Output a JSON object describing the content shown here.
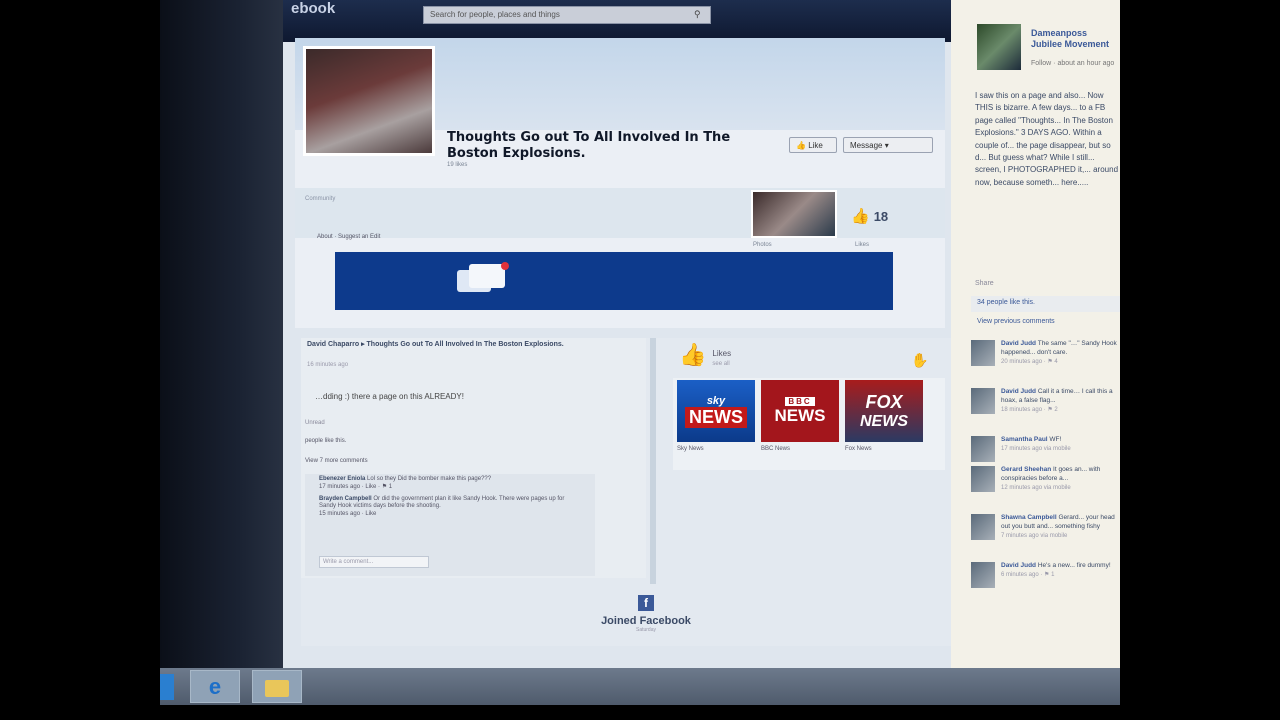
{
  "facebook": {
    "logo_text": "ebook",
    "search_placeholder": "Search for people, places and things"
  },
  "page": {
    "title": "Thoughts Go out To All Involved In The Boston Explosions.",
    "subtitle": "19 likes",
    "like_button": "Like",
    "message_button": "Message",
    "info_text": "Community",
    "tab_links": "About · Suggest an Edit",
    "photos_label": "Photos",
    "likes_count": "18",
    "likes_label": "Likes"
  },
  "post": {
    "author_line": "David Chaparro ▸ Thoughts Go out To All Involved In The Boston Explosions.",
    "time": "16 minutes ago",
    "body": "…dding :) there a page on this ALREADY!",
    "header": "Unread",
    "likes_this": "people like this.",
    "view_more": "View 7 more comments",
    "comments": [
      {
        "author": "Ebenezer Eniola",
        "text": "Lol so they Did the bomber make this page???",
        "meta": "17 minutes ago · Like · ⚑ 1"
      },
      {
        "author": "Brayden Campbell",
        "text": "Or did the government plan it like Sandy Hook. There were pages up for Sandy Hook victims days before the shooting.",
        "meta": "15 minutes ago · Like"
      }
    ],
    "write_comment": "Write a comment..."
  },
  "likes_panel": {
    "label": "Likes",
    "count": "see all",
    "news": [
      {
        "line1": "sky",
        "line2": "NEWS",
        "caption": "Sky News"
      },
      {
        "line1": "BBC",
        "line2": "NEWS",
        "caption": "BBC News"
      },
      {
        "line1": "FOX",
        "line2": "NEWS",
        "caption": "Fox News"
      }
    ]
  },
  "joined": {
    "icon": "f",
    "title": "Joined Facebook",
    "date": "Saturday"
  },
  "sidebar": {
    "name": "Dameanposs Jubilee Movement",
    "follow": "Follow · about an hour ago",
    "text": "I saw this on a page and also... Now THIS is bizarre. A few days... to a FB page called \"Thoughts... In The Boston Explosions.\" 3 DAYS AGO. Within a couple of... the page disappear, but so d... But guess what? While I still... screen, I PHOTOGRAPHED it,... around now, because someth... here.....",
    "share": "Share",
    "likes_line": "34 people like this.",
    "view_previous": "View previous comments",
    "comments": [
      {
        "author": "David Judd",
        "text": "The same \"…\" Sandy Hook happened... don't care.",
        "meta": "20 minutes ago · ⚑ 4"
      },
      {
        "author": "David Judd",
        "text": "Call it a time… I call this a hoax, a false flag...",
        "meta": "18 minutes ago · ⚑ 2"
      },
      {
        "author": "Samantha Paul",
        "text": "WF!",
        "meta": "17 minutes ago via mobile"
      },
      {
        "author": "Gerard Sheehan",
        "text": "It goes an... with conspiracies before a...",
        "meta": "12 minutes ago via mobile"
      },
      {
        "author": "Shawna Campbell",
        "text": "Gerard... your head out you butt and... something fishy",
        "meta": "7 minutes ago via mobile"
      },
      {
        "author": "David Judd",
        "text": "He's a new... fire dummy!",
        "meta": "6 minutes ago · ⚑ 1"
      }
    ]
  },
  "taskbar": {
    "ie_icon": "e"
  }
}
